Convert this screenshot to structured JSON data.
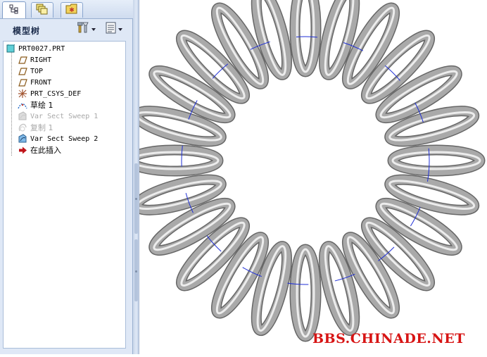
{
  "tabs": [
    {
      "id": "model-tree",
      "icon": "model-tree-icon"
    },
    {
      "id": "layers",
      "icon": "layers-icon"
    },
    {
      "id": "favorites",
      "icon": "favorites-folder-icon"
    }
  ],
  "tree_panel": {
    "title": "模型树",
    "settings_icon": "tree-settings-icon",
    "show_icon": "tree-show-icon"
  },
  "tree": {
    "root": {
      "label": "PRT0027.PRT",
      "icon": "part-icon"
    },
    "items": [
      {
        "label": "RIGHT",
        "icon": "datum-plane-icon",
        "disabled": false
      },
      {
        "label": "TOP",
        "icon": "datum-plane-icon",
        "disabled": false
      },
      {
        "label": "FRONT",
        "icon": "datum-plane-icon",
        "disabled": false
      },
      {
        "label": "PRT_CSYS_DEF",
        "icon": "coordinate-system-icon",
        "disabled": false
      },
      {
        "label": "草绘 1",
        "icon": "sketch-icon",
        "disabled": false
      },
      {
        "label": "Var Sect Sweep 1",
        "icon": "sweep-icon",
        "disabled": true
      },
      {
        "label": "复制 1",
        "icon": "copy-feature-icon",
        "disabled": true
      },
      {
        "label": "Var Sect Sweep 2",
        "icon": "sweep-icon",
        "disabled": false
      },
      {
        "label": "在此插入",
        "icon": "insert-here-arrow-icon",
        "disabled": false
      }
    ]
  },
  "graphics": {
    "model": "toroidal-coil-spring",
    "coil_count": 24,
    "spring_color": "#a9a9a9",
    "sweep_path_color": "#1f2fd6"
  },
  "watermark": {
    "text": "BBS.CHINADE.NET",
    "color": "#d71414"
  }
}
